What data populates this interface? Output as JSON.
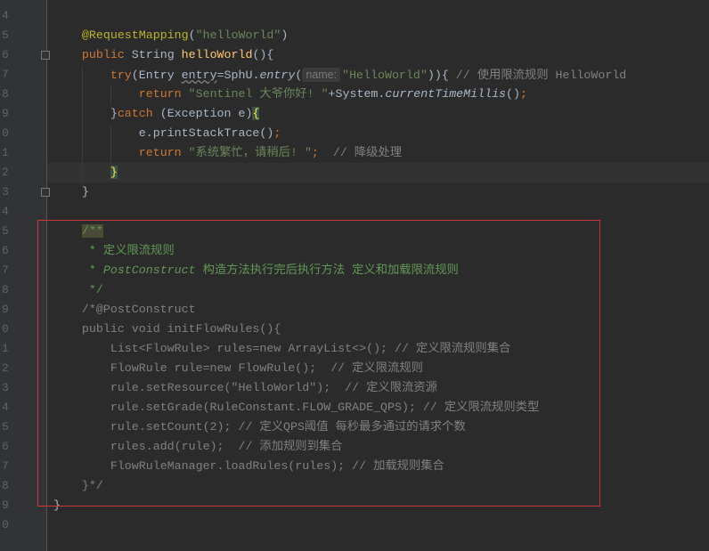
{
  "editor": {
    "colors": {
      "keyword": "#cc7832",
      "string": "#6a8759",
      "annotation": "#bbb529",
      "method": "#ffc66d",
      "comment": "#808080",
      "doc_comment": "#629755",
      "highlight_box": "#d0353a"
    },
    "current_line_index": 8,
    "lines": [
      {
        "num": "4",
        "tokens": []
      },
      {
        "num": "5",
        "tokens": [
          {
            "t": "    "
          },
          {
            "t": "@RequestMapping",
            "c": "ann"
          },
          {
            "t": "("
          },
          {
            "t": "\"helloWorld\"",
            "c": "str"
          },
          {
            "t": ")"
          }
        ]
      },
      {
        "num": "6",
        "tokens": [
          {
            "t": "    "
          },
          {
            "t": "public",
            "c": "kw"
          },
          {
            "t": " String "
          },
          {
            "t": "helloWorld",
            "c": "fn"
          },
          {
            "t": "(){"
          }
        ]
      },
      {
        "num": "7",
        "tokens": [
          {
            "t": "        "
          },
          {
            "t": "try",
            "c": "kw"
          },
          {
            "t": "(Entry "
          },
          {
            "t": "entry",
            "c": "wavy"
          },
          {
            "t": "=SphU."
          },
          {
            "t": "entry",
            "c": "it"
          },
          {
            "t": "("
          },
          {
            "t": "name:",
            "c": "hint"
          },
          {
            "t": "\"HelloWorld\"",
            "c": "str"
          },
          {
            "t": ")){ "
          },
          {
            "t": "// 使用限流规则 HelloWorld",
            "c": "cmt"
          }
        ]
      },
      {
        "num": "8",
        "tokens": [
          {
            "t": "            "
          },
          {
            "t": "return ",
            "c": "kw"
          },
          {
            "t": "\"Sentinel 大爷你好! \"",
            "c": "str"
          },
          {
            "t": "+System."
          },
          {
            "t": "currentTimeMillis",
            "c": "it"
          },
          {
            "t": "()"
          },
          {
            "t": ";",
            "c": "kw"
          }
        ]
      },
      {
        "num": "9",
        "tokens": [
          {
            "t": "        }"
          },
          {
            "t": "catch",
            "c": "kw"
          },
          {
            "t": " (Exception e)"
          },
          {
            "t": "{",
            "c": "hl"
          }
        ]
      },
      {
        "num": "0",
        "tokens": [
          {
            "t": "            e.printStackTrace()"
          },
          {
            "t": ";",
            "c": "kw"
          }
        ]
      },
      {
        "num": "1",
        "tokens": [
          {
            "t": "            "
          },
          {
            "t": "return ",
            "c": "kw"
          },
          {
            "t": "\"系统繁忙，请稍后! \"",
            "c": "str"
          },
          {
            "t": ";",
            "c": "kw"
          },
          {
            "t": "  // 降级处理",
            "c": "cmt"
          }
        ]
      },
      {
        "num": "2",
        "tokens": [
          {
            "t": "        "
          },
          {
            "t": "}",
            "c": "hl"
          }
        ]
      },
      {
        "num": "3",
        "tokens": [
          {
            "t": "    }"
          }
        ]
      },
      {
        "num": "4",
        "tokens": []
      },
      {
        "num": "5",
        "tokens": [
          {
            "t": "    "
          },
          {
            "t": "/**",
            "c": "doc docbg"
          }
        ]
      },
      {
        "num": "6",
        "tokens": [
          {
            "t": "     * 定义限流规则",
            "c": "doc"
          }
        ]
      },
      {
        "num": "7",
        "tokens": [
          {
            "t": "     * ",
            "c": "doc"
          },
          {
            "t": "PostConstruct",
            "c": "doc it"
          },
          {
            "t": " 构造方法执行完后执行方法 定义和加载限流规则",
            "c": "doc"
          }
        ]
      },
      {
        "num": "8",
        "tokens": [
          {
            "t": "     */",
            "c": "doc"
          }
        ]
      },
      {
        "num": "9",
        "tokens": [
          {
            "t": "    /*@PostConstruct",
            "c": "cmt"
          }
        ]
      },
      {
        "num": "0",
        "tokens": [
          {
            "t": "    public void initFlowRules(){",
            "c": "cmt"
          }
        ]
      },
      {
        "num": "1",
        "tokens": [
          {
            "t": "        List<FlowRule> rules=new ArrayList<>(); // 定义限流规则集合",
            "c": "cmt"
          }
        ]
      },
      {
        "num": "2",
        "tokens": [
          {
            "t": "        FlowRule rule=new FlowRule();  // 定义限流规则",
            "c": "cmt"
          }
        ]
      },
      {
        "num": "3",
        "tokens": [
          {
            "t": "        rule.setResource(\"HelloWorld\");  // 定义限流资源",
            "c": "cmt"
          }
        ]
      },
      {
        "num": "4",
        "tokens": [
          {
            "t": "        rule.setGrade(RuleConstant.FLOW_GRADE_QPS); // 定义限流规则类型",
            "c": "cmt"
          }
        ]
      },
      {
        "num": "5",
        "tokens": [
          {
            "t": "        rule.setCount(2); // 定义QPS阈值 每秒最多通过的请求个数",
            "c": "cmt"
          }
        ]
      },
      {
        "num": "6",
        "tokens": [
          {
            "t": "        rules.add(rule);  // 添加规则到集合",
            "c": "cmt"
          }
        ]
      },
      {
        "num": "7",
        "tokens": [
          {
            "t": "        FlowRuleManager.loadRules(rules); // 加载规则集合",
            "c": "cmt"
          }
        ]
      },
      {
        "num": "8",
        "tokens": [
          {
            "t": "    }*/",
            "c": "cmt"
          }
        ]
      },
      {
        "num": "9",
        "tokens": [
          {
            "t": "}"
          }
        ]
      },
      {
        "num": "0",
        "tokens": []
      }
    ]
  }
}
